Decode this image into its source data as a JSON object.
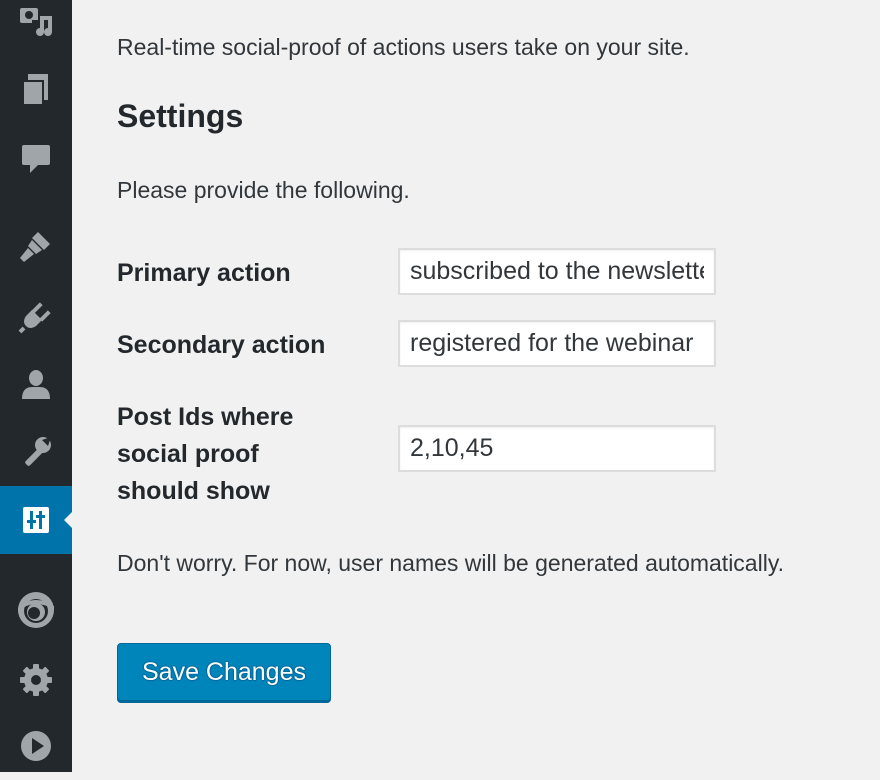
{
  "sidebar": {
    "items": [
      {
        "name": "media-icon",
        "current": false
      },
      {
        "name": "pages-icon",
        "current": false
      },
      {
        "name": "comments-icon",
        "current": false
      },
      {
        "name": "appearance-icon",
        "current": false
      },
      {
        "name": "plugins-icon",
        "current": false
      },
      {
        "name": "users-icon",
        "current": false
      },
      {
        "name": "tools-icon",
        "current": false
      },
      {
        "name": "settings-sliders-icon",
        "current": true
      },
      {
        "name": "swirl-plugin-icon",
        "current": false
      },
      {
        "name": "gear-icon",
        "current": false
      },
      {
        "name": "play-icon",
        "current": false
      }
    ],
    "colors": {
      "background": "#23282d",
      "icon": "#a0a5aa",
      "current_bg": "#0073aa",
      "current_icon": "#ffffff"
    }
  },
  "main": {
    "tagline": "Real-time social-proof of actions users take on your site.",
    "settings_title": "Settings",
    "instruction": "Please provide the following.",
    "fields": {
      "primary_action": {
        "label": "Primary action",
        "value": "subscribed to the newsletter"
      },
      "secondary_action": {
        "label": "Secondary action",
        "value": "registered for the webinar"
      },
      "post_ids": {
        "label_lines": [
          "Post Ids where",
          "social proof",
          "should show"
        ],
        "value": "2,10,45"
      }
    },
    "note": "Don't worry. For now, user names will be generated automatically.",
    "save_label": "Save Changes"
  },
  "colors": {
    "accent": "#0085ba",
    "page_background": "#f1f1f1",
    "text": "#23282d"
  }
}
